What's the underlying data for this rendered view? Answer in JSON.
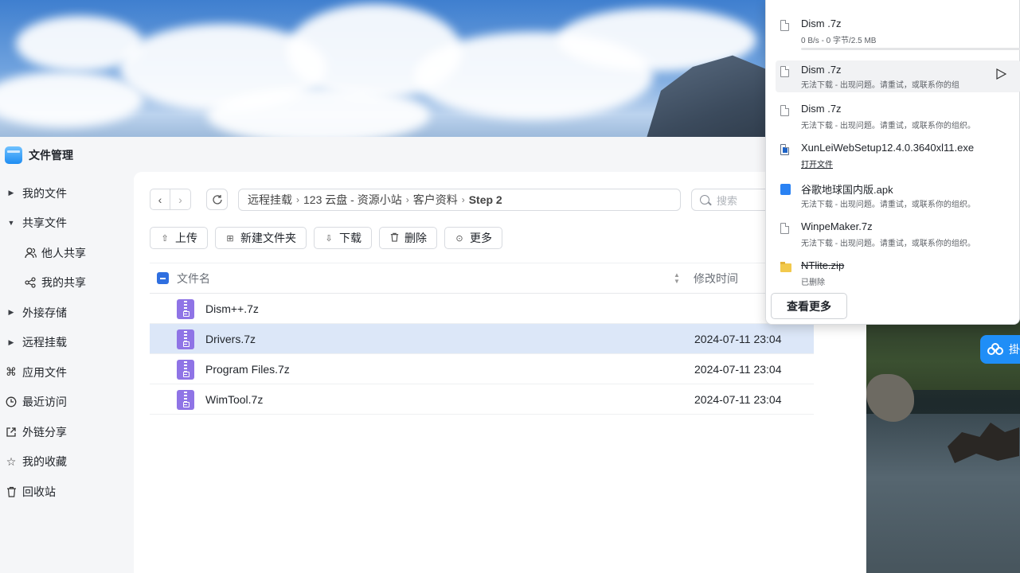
{
  "app": {
    "title": "文件管理"
  },
  "sidebar": {
    "items": [
      {
        "label": "我的文件"
      },
      {
        "label": "共享文件"
      },
      {
        "label": "他人共享"
      },
      {
        "label": "我的共享"
      },
      {
        "label": "外接存储"
      },
      {
        "label": "远程挂载"
      },
      {
        "label": "应用文件"
      },
      {
        "label": "最近访问"
      },
      {
        "label": "外链分享"
      },
      {
        "label": "我的收藏"
      },
      {
        "label": "回收站"
      }
    ]
  },
  "breadcrumb": [
    "远程挂载",
    "123 云盘 - 资源小站",
    "客户资料",
    "Step 2"
  ],
  "search": {
    "placeholder": "搜索"
  },
  "toolbar": {
    "upload": "上传",
    "new_folder": "新建文件夹",
    "download": "下载",
    "delete": "删除",
    "more": "更多"
  },
  "table": {
    "headers": {
      "name": "文件名",
      "modified": "修改时间"
    },
    "rows": [
      {
        "name": "Dism++.7z",
        "modified": ""
      },
      {
        "name": "Drivers.7z",
        "modified": "2024-07-11 23:04"
      },
      {
        "name": "Program Files.7z",
        "modified": "2024-07-11 23:04"
      },
      {
        "name": "WimTool.7z",
        "modified": "2024-07-11 23:04"
      }
    ]
  },
  "downloads": {
    "items": [
      {
        "name": "Dism .7z",
        "status": "0 B/s - 0 字节/2.5 MB",
        "progress": 0
      },
      {
        "name": "Dism .7z",
        "status": "无法下载 - 出现问题。请重试，或联系你的组"
      },
      {
        "name": "Dism .7z",
        "status": "无法下载 - 出现问题。请重试，或联系你的组织。"
      },
      {
        "name": "XunLeiWebSetup12.4.0.3640xl11.exe",
        "status": "打开文件"
      },
      {
        "name": "谷歌地球国内版.apk",
        "status": "无法下载 - 出现问题。请重试，或联系你的组织。"
      },
      {
        "name": "WinpeMaker.7z",
        "status": "无法下载 - 出现问题。请重试，或联系你的组织。"
      },
      {
        "name": "NTlite.zip",
        "status": "已删除"
      }
    ],
    "see_more": "查看更多"
  },
  "float_button": {
    "label": "掛"
  },
  "colors": {
    "accent": "#2f6fe0",
    "selected_row": "#dce7f8",
    "zip_icon": "#8f74e6"
  }
}
